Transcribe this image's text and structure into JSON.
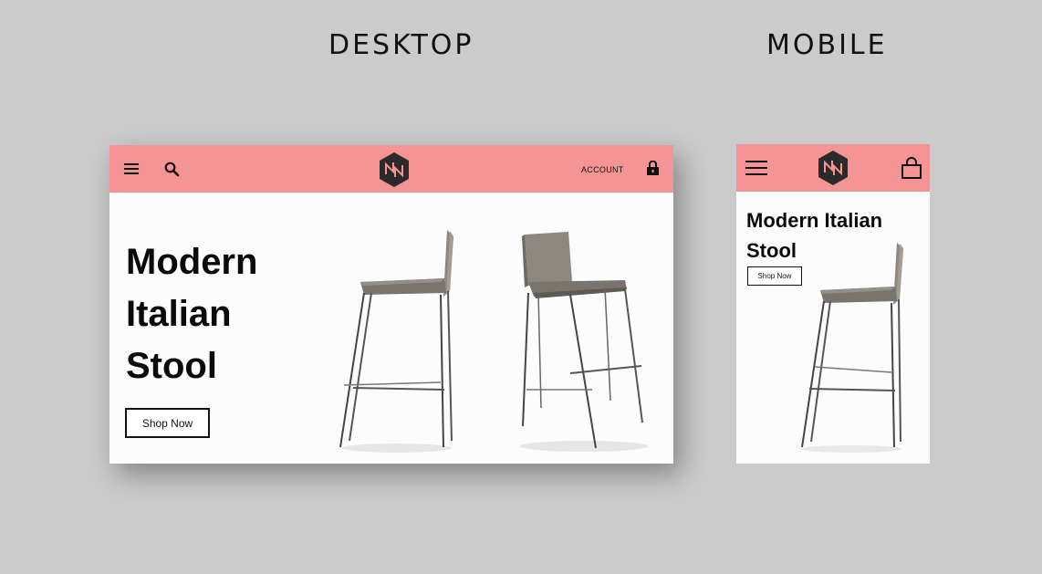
{
  "labels": {
    "desktop": "DESKTOP",
    "mobile": "MOBILE"
  },
  "desktop": {
    "header": {
      "menu_icon": "hamburger-menu-icon",
      "search_icon": "search-icon",
      "logo": "hexagon-logo",
      "account_label": "ACCOUNT",
      "cart_icon": "shopping-bag-icon",
      "background": "#f49494"
    },
    "hero": {
      "title_line1": "Modern",
      "title_line2": "Italian",
      "title_line3": "Stool",
      "button_label": "Shop Now"
    }
  },
  "mobile": {
    "header": {
      "menu_icon": "hamburger-menu-icon",
      "logo": "hexagon-logo",
      "cart_icon": "shopping-bag-icon",
      "background": "#f49494"
    },
    "hero": {
      "title": "Modern Italian Stool",
      "button_label": "Shop Now"
    }
  }
}
